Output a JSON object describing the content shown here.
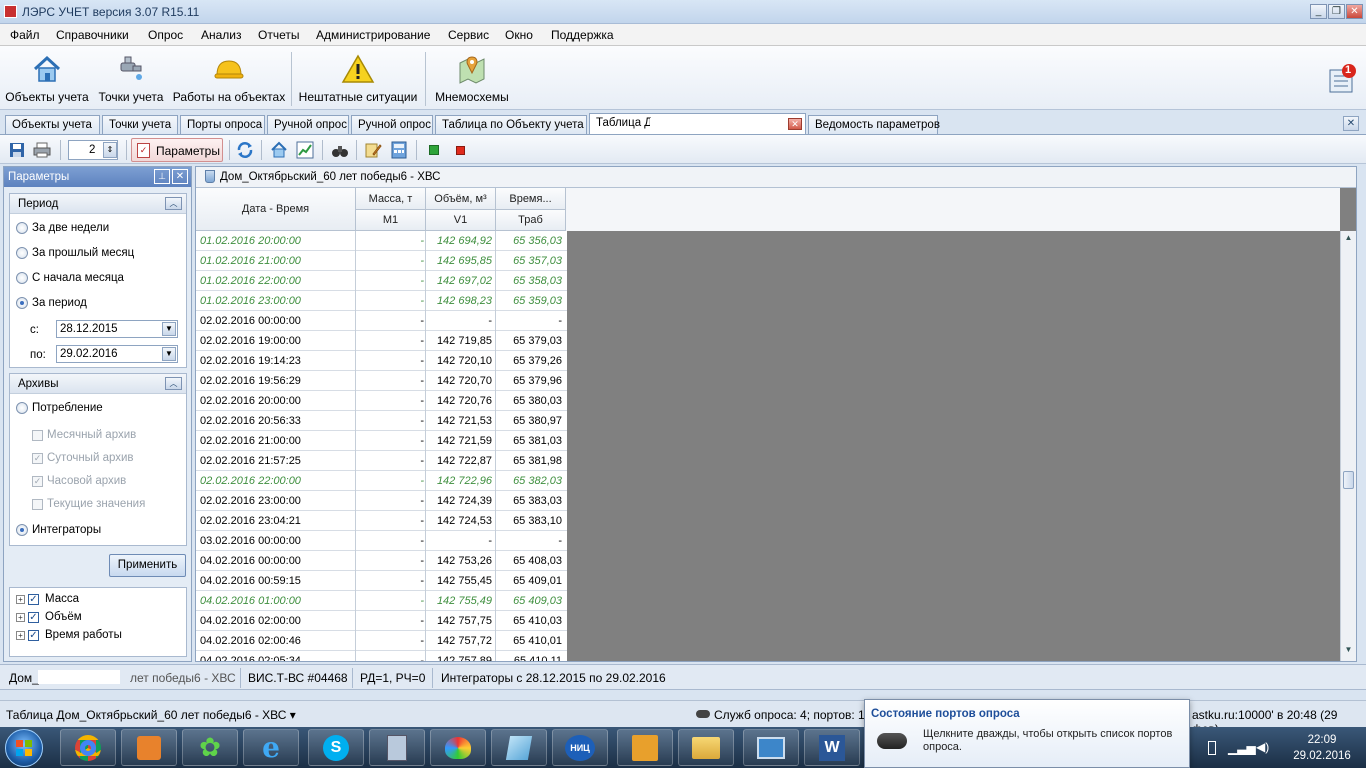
{
  "app": {
    "title": "ЛЭРС УЧЕТ версия 3.07 R15.11",
    "min": "_",
    "restore": "❐",
    "close": "✕"
  },
  "menu": [
    "Файл",
    "Справочники",
    "Опрос",
    "Анализ",
    "Отчеты",
    "Администрирование",
    "Сервис",
    "Окно",
    "Поддержка"
  ],
  "big_toolbar": {
    "objects": "Объекты учета",
    "points": "Точки учета",
    "works": "Работы на объектах",
    "alarms": "Нештатные ситуации",
    "mnemo": "Мнемосхемы",
    "notify_count": "1"
  },
  "tabs": [
    "Объекты учета",
    "Точки учета",
    "Порты опроса",
    "Ручной опрос",
    "Ручной опрос",
    "Таблица по Объекту учета",
    "Таблица Д",
    "Ведомость параметров"
  ],
  "small_toolbar": {
    "page_value": "2",
    "params_label": "Параметры"
  },
  "left_panel": {
    "title": "Параметры",
    "period": {
      "title": "Период",
      "options": [
        "За две недели",
        "За прошлый месяц",
        "С начала месяца",
        "За период"
      ],
      "from_label": "с:",
      "from_value": "28.12.2015",
      "to_label": "по:",
      "to_value": "29.02.2016"
    },
    "archives": {
      "title": "Архивы",
      "consumption": "Потребление",
      "checks": [
        "Месячный архив",
        "Суточный архив",
        "Часовой архив",
        "Текущие значения"
      ],
      "integrators": "Интеграторы"
    },
    "apply": "Применить",
    "tree": [
      "Масса",
      "Объём",
      "Время работы"
    ]
  },
  "grid": {
    "title": "Дом_Октябрьский_60 лет победы6 - ХВС",
    "headers": {
      "datetime": "Дата - Время",
      "mass": "Масса, т",
      "mass_sub": "M1",
      "volume": "Объём, м³",
      "volume_sub": "V1",
      "time": "Время...",
      "time_sub": "Траб"
    },
    "rows": [
      {
        "dt": "01.02.2016 20:00:00",
        "m": "-",
        "v": "142 694,92",
        "t": "65 356,03",
        "italic": true
      },
      {
        "dt": "01.02.2016 21:00:00",
        "m": "-",
        "v": "142 695,85",
        "t": "65 357,03",
        "italic": true
      },
      {
        "dt": "01.02.2016 22:00:00",
        "m": "-",
        "v": "142 697,02",
        "t": "65 358,03",
        "italic": true
      },
      {
        "dt": "01.02.2016 23:00:00",
        "m": "-",
        "v": "142 698,23",
        "t": "65 359,03",
        "italic": true
      },
      {
        "dt": "02.02.2016 00:00:00",
        "m": "-",
        "v": "-",
        "t": "-",
        "italic": false
      },
      {
        "dt": "02.02.2016 19:00:00",
        "m": "-",
        "v": "142 719,85",
        "t": "65 379,03",
        "italic": false
      },
      {
        "dt": "02.02.2016 19:14:23",
        "m": "-",
        "v": "142 720,10",
        "t": "65 379,26",
        "italic": false
      },
      {
        "dt": "02.02.2016 19:56:29",
        "m": "-",
        "v": "142 720,70",
        "t": "65 379,96",
        "italic": false
      },
      {
        "dt": "02.02.2016 20:00:00",
        "m": "-",
        "v": "142 720,76",
        "t": "65 380,03",
        "italic": false
      },
      {
        "dt": "02.02.2016 20:56:33",
        "m": "-",
        "v": "142 721,53",
        "t": "65 380,97",
        "italic": false
      },
      {
        "dt": "02.02.2016 21:00:00",
        "m": "-",
        "v": "142 721,59",
        "t": "65 381,03",
        "italic": false
      },
      {
        "dt": "02.02.2016 21:57:25",
        "m": "-",
        "v": "142 722,87",
        "t": "65 381,98",
        "italic": false
      },
      {
        "dt": "02.02.2016 22:00:00",
        "m": "-",
        "v": "142 722,96",
        "t": "65 382,03",
        "italic": true
      },
      {
        "dt": "02.02.2016 23:00:00",
        "m": "-",
        "v": "142 724,39",
        "t": "65 383,03",
        "italic": false
      },
      {
        "dt": "02.02.2016 23:04:21",
        "m": "-",
        "v": "142 724,53",
        "t": "65 383,10",
        "italic": false
      },
      {
        "dt": "03.02.2016 00:00:00",
        "m": "-",
        "v": "-",
        "t": "-",
        "italic": false
      },
      {
        "dt": "04.02.2016 00:00:00",
        "m": "-",
        "v": "142 753,26",
        "t": "65 408,03",
        "italic": false
      },
      {
        "dt": "04.02.2016 00:59:15",
        "m": "-",
        "v": "142 755,45",
        "t": "65 409,01",
        "italic": false
      },
      {
        "dt": "04.02.2016 01:00:00",
        "m": "-",
        "v": "142 755,49",
        "t": "65 409,03",
        "italic": true
      },
      {
        "dt": "04.02.2016 02:00:00",
        "m": "-",
        "v": "142 757,75",
        "t": "65 410,03",
        "italic": false
      },
      {
        "dt": "04.02.2016 02:00:46",
        "m": "-",
        "v": "142 757,72",
        "t": "65 410,01",
        "italic": false
      },
      {
        "dt": "04.02.2016 02:05:34",
        "m": "-",
        "v": "142 757,89",
        "t": "65 410,11",
        "italic": false
      }
    ]
  },
  "status1": {
    "object": "Дом_",
    "object_tail": "лет победы6 - ХВС",
    "device": "ВИС.Т-ВС #04468",
    "rd": "РД=1, РЧ=0",
    "range": "Интеграторы с 28.12.2015 по 29.02.2016"
  },
  "status2": {
    "left": "Таблица Дом_Октябрьский_60 лет победы6 - ХВС ▾",
    "services": "Служб опроса: 4; портов: 1",
    "right": "astku.ru:10000' в 20:48 (29 фев)"
  },
  "balloon": {
    "title": "Состояние портов опроса",
    "text": "Щелкните дважды, чтобы открыть список портов опроса."
  },
  "clock": {
    "time": "22:09",
    "date": "29.02.2016"
  },
  "taskbar": {
    "nic_label": "НИЦ",
    "word_label": "W"
  }
}
